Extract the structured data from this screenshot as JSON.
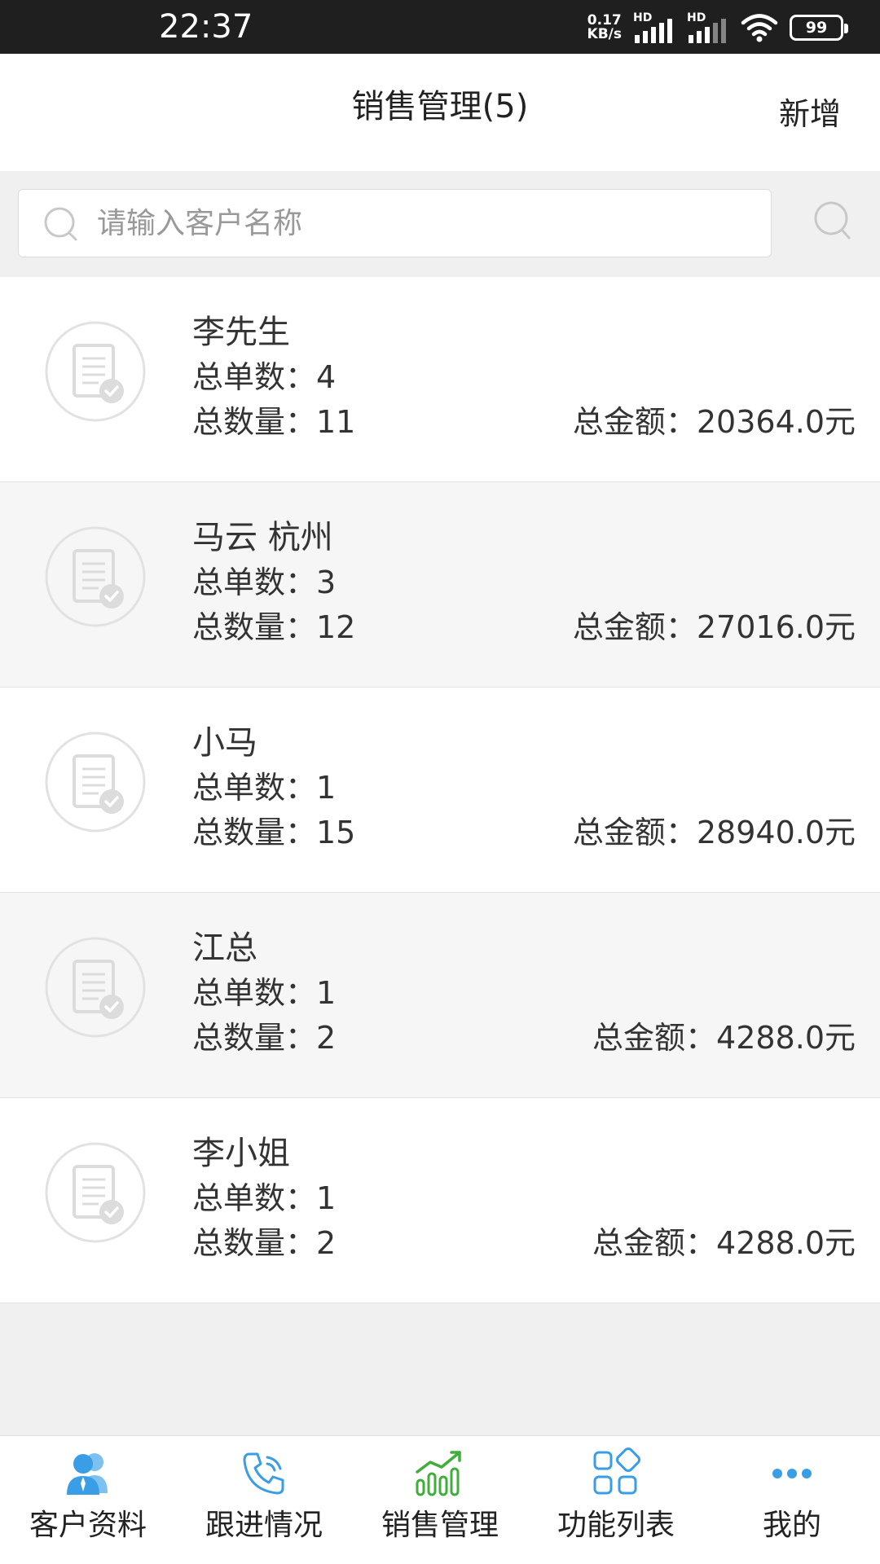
{
  "status_bar": {
    "time": "22:37",
    "net_speed_value": "0.17",
    "net_speed_unit": "KB/s",
    "sim1_label": "HD",
    "sim2_label": "HD",
    "battery": "99"
  },
  "header": {
    "title": "销售管理(5)",
    "add_label": "新增"
  },
  "search": {
    "placeholder": "请输入客户名称",
    "value": ""
  },
  "customers": [
    {
      "name": "李先生",
      "orders": "总单数：4",
      "quantity": "总数量：11",
      "amount": "总金额：20364.0元"
    },
    {
      "name": "马云 杭州",
      "orders": "总单数：3",
      "quantity": "总数量：12",
      "amount": "总金额：27016.0元"
    },
    {
      "name": "小马",
      "orders": "总单数：1",
      "quantity": "总数量：15",
      "amount": "总金额：28940.0元"
    },
    {
      "name": "江总",
      "orders": "总单数：1",
      "quantity": "总数量：2",
      "amount": "总金额：4288.0元"
    },
    {
      "name": "李小姐",
      "orders": "总单数：1",
      "quantity": "总数量：2",
      "amount": "总金额：4288.0元"
    }
  ],
  "bottom_nav": [
    {
      "label": "客户资料",
      "icon": "customer-profile-icon",
      "color": "#3a9ee6"
    },
    {
      "label": "跟进情况",
      "icon": "phone-icon",
      "color": "#3a9ee6"
    },
    {
      "label": "销售管理",
      "icon": "sales-chart-icon",
      "color": "#3fae3a",
      "active": true
    },
    {
      "label": "功能列表",
      "icon": "grid-icon",
      "color": "#3a9ee6"
    },
    {
      "label": "我的",
      "icon": "more-dots-icon",
      "color": "#3a9ee6"
    }
  ],
  "colors": {
    "status_bar_bg": "#1f1f1f",
    "accent_blue": "#3a9ee6",
    "accent_green": "#3fae3a",
    "list_alt_bg": "#f7f6f7"
  }
}
